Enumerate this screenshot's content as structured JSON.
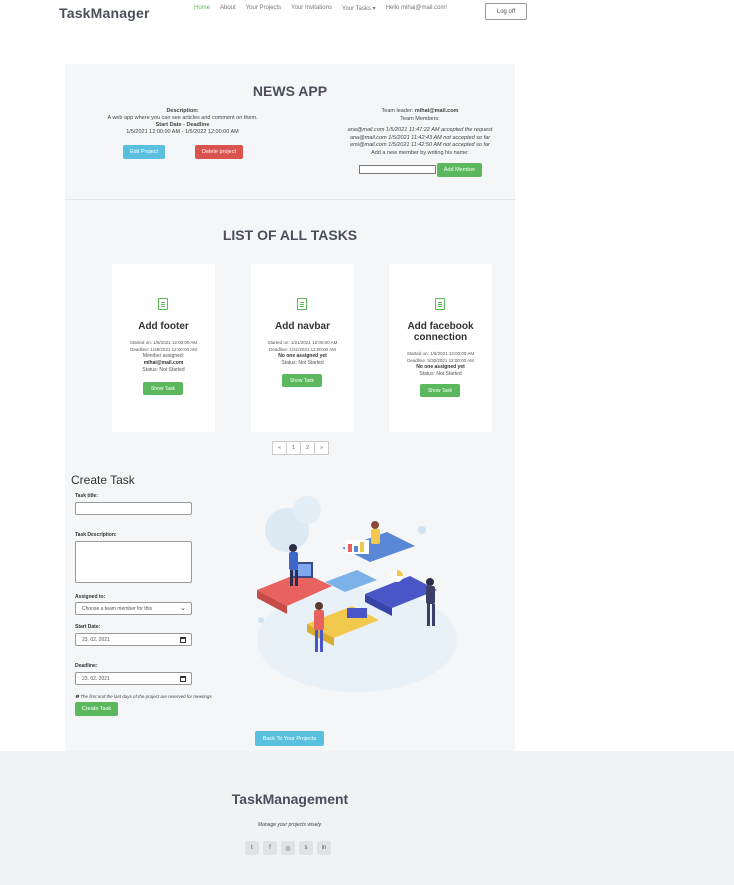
{
  "brand": "TaskManager",
  "nav": {
    "links": [
      "Home",
      "About",
      "Your Projects",
      "Your Invitations",
      "Your Tasks ▾",
      "Hello mihai@mail.com!"
    ],
    "logoff": "Log off"
  },
  "project": {
    "title": "NEWS APP",
    "description_label": "Description:",
    "description": "A web app where you can see articles and comment on them.",
    "dates_label": "Start Date - Deadline",
    "dates": "1/5/2021 12:00:00 AM - 1/5/2022 12:00:00 AM",
    "edit_label": "Edit Project",
    "delete_label": "Delete project",
    "team_leader_label": "Team leader:",
    "team_leader": "mihai@mail.com",
    "team_members_label": "Team Members:",
    "members": [
      "ana@mail.com 1/5/2021 11:47:22 AM accepted the request",
      "ana@mail.com 1/5/2021 11:42:43 AM not accepted so far",
      "emi@mail.com 1/5/2021 11:42:50 AM not accepted so far"
    ],
    "add_member_hint": "Add a new member by writing his name:",
    "add_member_label": "Add Member"
  },
  "tasks_title": "LIST OF ALL TASKS",
  "tasks": [
    {
      "name": "Add footer",
      "started": "Started on: 1/6/2021 12:00:00 AM",
      "deadline": "Deadline: 1/28/2021 12:00:00 AM",
      "assign_label": "Member assigned:",
      "assigned": "mihai@mail.com",
      "status": "Status: Not Started",
      "button": "Show Task"
    },
    {
      "name": "Add navbar",
      "started": "Started on: 1/21/2021 12:00:00 AM",
      "deadline": "Deadline: 1/31/2021 12:00:00 AM",
      "assigned": "No one assigned yet",
      "status": "Status: Not Started",
      "button": "Show Task"
    },
    {
      "name": "Add facebook connection",
      "started": "Started on: 1/9/2021 12:00:00 AM",
      "deadline": "Deadline: 5/30/2021 12:00:00 AM",
      "assigned": "No one assigned yet",
      "status": "Status: Not Started",
      "button": "Show Task"
    }
  ],
  "pager": [
    "«",
    "1",
    "2",
    "»"
  ],
  "create": {
    "title": "Create Task",
    "title_label": "Task title:",
    "description_label": "Task Description:",
    "assigned_label": "Assigned to:",
    "assigned_placeholder": "Choose a team member for this",
    "start_label": "Start Date:",
    "start_value": "23. 02. 2021",
    "deadline_label": "Deadline:",
    "deadline_value": "23. 02. 2021",
    "note": "❶ The first and the last days of the project are reserved for meetings",
    "create_label": "Create Task",
    "back_label": "Back To Your Projects"
  },
  "footer": {
    "brand": "TaskManagement",
    "tagline": "Manage your projects wisely.",
    "socials": [
      "twitter-icon",
      "facebook-icon",
      "instagram-icon",
      "skype-icon",
      "linkedin-icon"
    ]
  },
  "colors": {
    "success": "#5cb85c",
    "info": "#5bc0de",
    "danger": "#d9534f",
    "heading": "#4a4f5a"
  }
}
